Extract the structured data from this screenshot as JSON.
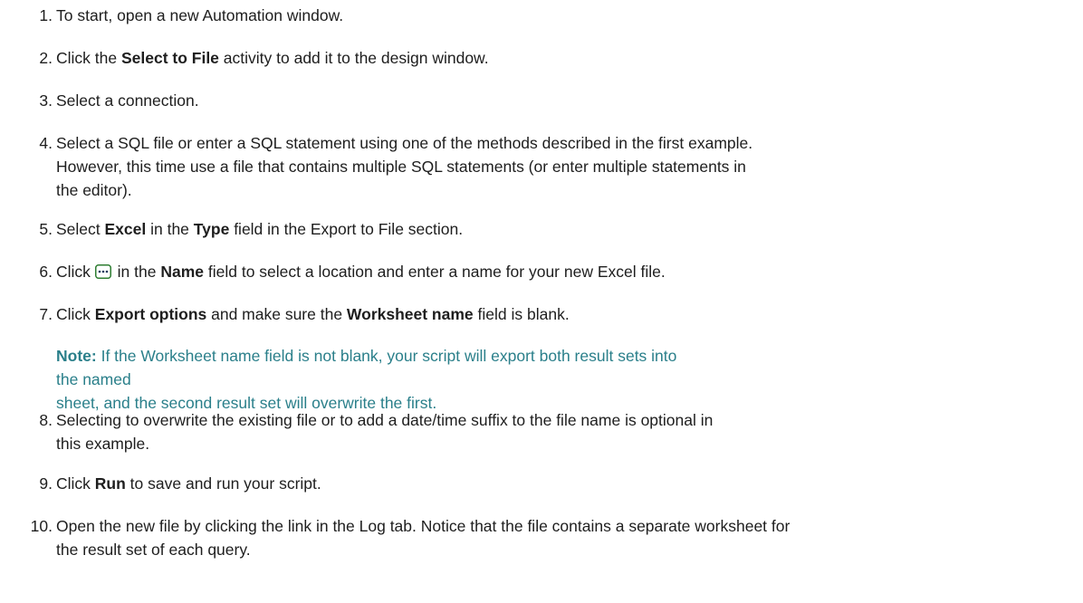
{
  "steps": [
    {
      "num": "1.",
      "parts": [
        "To start, open a new Automation window."
      ]
    },
    {
      "num": "2.",
      "parts": [
        "Click the ",
        "Select to File",
        " activity to add it to the design window."
      ]
    },
    {
      "num": "3.",
      "parts": [
        "Select a connection."
      ]
    },
    {
      "num": "4.",
      "lines": [
        "Select a SQL file or enter a SQL statement using one of the methods described in the first example.",
        "However, this time use a file that contains multiple SQL statements (or enter multiple statements in",
        "the editor)."
      ]
    },
    {
      "num": "5.",
      "parts": [
        "Select ",
        "Excel",
        " in the ",
        "Type",
        " field in the Export to File section."
      ]
    },
    {
      "num": "6.",
      "parts": [
        "Click ",
        " in the ",
        "Name",
        " field to select a location and enter a name for your new Excel file."
      ]
    },
    {
      "num": "7.",
      "parts": [
        "Click ",
        "Export options",
        " and make sure the ",
        "Worksheet name",
        " field is blank."
      ]
    },
    {
      "num": "8.",
      "lines": [
        "Selecting to overwrite the existing file or to add a date/time suffix to the file name is optional in",
        "this example."
      ]
    },
    {
      "num": "9.",
      "parts": [
        "Click ",
        "Run",
        " to save and run your script."
      ]
    },
    {
      "num": "10.",
      "lines": [
        "Open the new file by clicking the link in the Log tab. Notice that the file contains a separate worksheet for",
        "the result set of each query."
      ]
    }
  ],
  "note": {
    "label": "Note:",
    "lines": [
      " If the Worksheet name field is not blank, your script will export both result sets into the named",
      "sheet, and the second result set will overwrite the first."
    ]
  },
  "icons": {
    "ellipsis_button": "ellipsis-button-icon"
  },
  "colors": {
    "note": "#2a7f8a",
    "icon_border": "#2e7d32"
  }
}
